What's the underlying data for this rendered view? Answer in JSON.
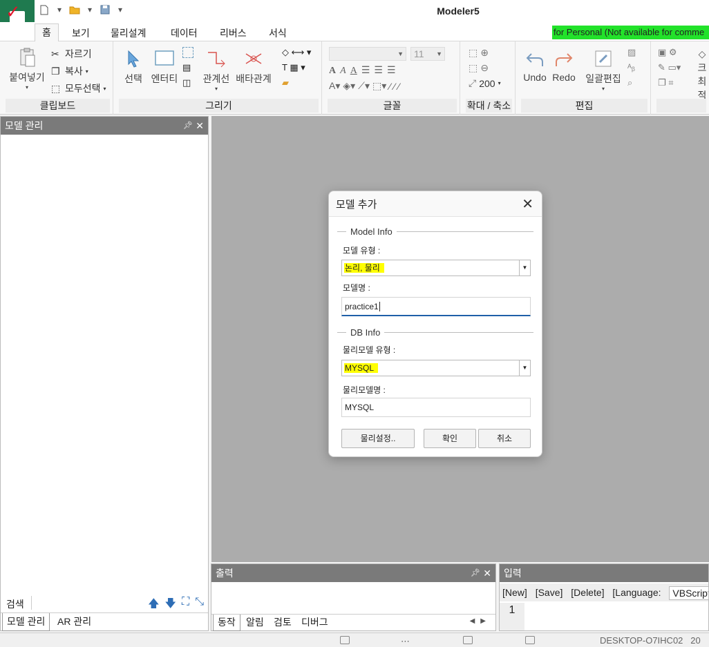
{
  "window": {
    "title": "Modeler5",
    "license_banner": "for Personal (Not available for comme"
  },
  "menu": {
    "tabs": [
      "홈",
      "보기",
      "물리설계",
      "데이터",
      "리버스",
      "서식"
    ]
  },
  "ribbon": {
    "clipboard": {
      "paste": "붙여넣기",
      "cut": "자르기",
      "copy": "복사",
      "select_all": "모두선택",
      "label": "클립보드"
    },
    "draw": {
      "select": "선택",
      "entity": "엔터티",
      "relation_line": "관계선",
      "exclusive_relation": "배타관계",
      "label": "그리기"
    },
    "font": {
      "size": "11",
      "label": "글꼴"
    },
    "zoom": {
      "value": "200",
      "label": "확대 / 축소"
    },
    "edit": {
      "undo": "Undo",
      "redo": "Redo",
      "batch_edit": "일괄편집",
      "label": "편집"
    },
    "overflow": {
      "label_a": "크",
      "label_b": "최적"
    }
  },
  "left_panel": {
    "title": "모델 관리",
    "search_label": "검색",
    "tabs": [
      "모델 관리",
      "AR 관리"
    ]
  },
  "output_panel": {
    "title": "출력",
    "tabs": [
      "동작",
      "알림",
      "검토",
      "디버그"
    ]
  },
  "input_panel": {
    "title": "입력",
    "toolbar": [
      "[New]",
      "[Save]",
      "[Delete]",
      "[Language:"
    ],
    "language": "VBScript",
    "line_number": "1"
  },
  "statusbar": {
    "host": "DESKTOP-O7IHC02",
    "extra": "20"
  },
  "dialog": {
    "title": "모델 추가",
    "model_info_legend": "Model Info",
    "model_type_label": "모델 유형 :",
    "model_type_value": "논리, 물리",
    "model_name_label": "모델명 :",
    "model_name_value": "practice1",
    "db_info_legend": "DB Info",
    "physical_type_label": "물리모델 유형 :",
    "physical_type_value": "MYSQL",
    "physical_name_label": "물리모델명 :",
    "physical_name_value": "MYSQL",
    "buttons": {
      "physical_settings": "물리설정..",
      "ok": "확인",
      "cancel": "취소"
    }
  },
  "colors": {
    "highlight": "#ffff00",
    "license_green": "#22e22a",
    "panel_header": "#7a7a7a",
    "canvas": "#acacac",
    "brand_green": "#1f7a4f"
  }
}
